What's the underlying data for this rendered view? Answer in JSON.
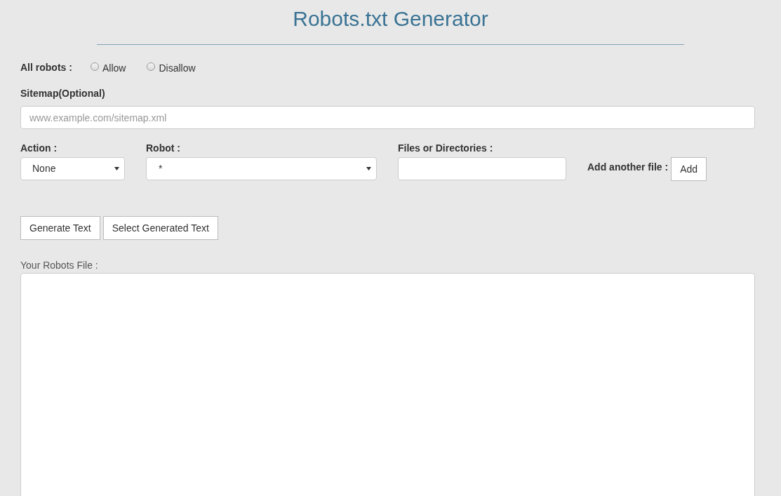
{
  "title": "Robots.txt Generator",
  "all_robots": {
    "label": "All robots :",
    "options": [
      {
        "label": "Allow",
        "selected": false
      },
      {
        "label": "Disallow",
        "selected": false
      }
    ]
  },
  "sitemap": {
    "label": "Sitemap(Optional)",
    "placeholder": "www.example.com/sitemap.xml"
  },
  "action": {
    "label": "Action :",
    "value": "None"
  },
  "robot": {
    "label": "Robot :",
    "value": "*"
  },
  "files": {
    "label": "Files or Directories :"
  },
  "add_another": {
    "label": "Add another file :",
    "button": "Add"
  },
  "buttons": [
    "Generate Text",
    "Select Generated Text"
  ],
  "output": {
    "label": "Your Robots File :"
  }
}
